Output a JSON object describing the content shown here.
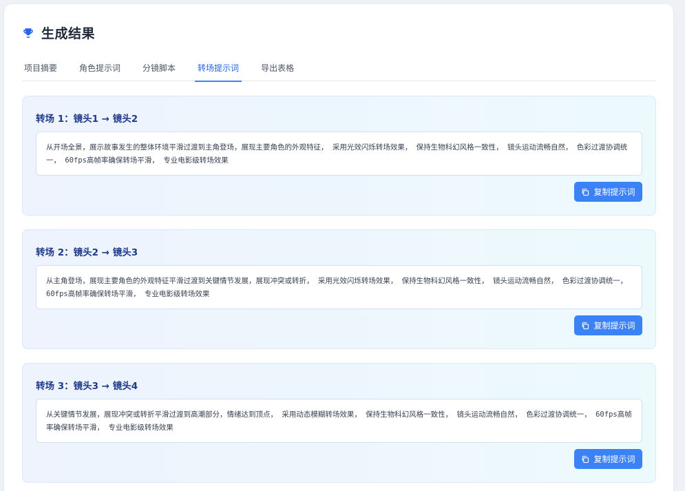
{
  "header": {
    "title": "生成结果",
    "icon": "trophy-icon"
  },
  "tabs": [
    {
      "label": "项目摘要"
    },
    {
      "label": "角色提示词"
    },
    {
      "label": "分镜脚本"
    },
    {
      "label": "转场提示词"
    },
    {
      "label": "导出表格"
    }
  ],
  "active_tab": "转场提示词",
  "cards": [
    {
      "title": "转场 1：镜头1 → 镜头2",
      "text": "从开场全景，展示故事发生的整体环境平滑过渡到主角登场，展现主要角色的外观特征， 采用光效闪烁转场效果， 保持生物科幻风格一致性， 镜头运动流畅自然， 色彩过渡协调统一， 60fps高帧率确保转场平滑， 专业电影级转场效果",
      "button": "复制提示词"
    },
    {
      "title": "转场 2：镜头2 → 镜头3",
      "text": "从主角登场，展现主要角色的外观特征平滑过渡到关键情节发展，展现冲突或转折， 采用光效闪烁转场效果， 保持生物科幻风格一致性， 镜头运动流畅自然， 色彩过渡协调统一， 60fps高帧率确保转场平滑， 专业电影级转场效果",
      "button": "复制提示词"
    },
    {
      "title": "转场 3：镜头3 → 镜头4",
      "text": "从关键情节发展，展现冲突或转折平滑过渡到高潮部分，情绪达到顶点， 采用动态模糊转场效果， 保持生物科幻风格一致性， 镜头运动流畅自然， 色彩过渡协调统一， 60fps高帧率确保转场平滑， 专业电影级转场效果",
      "button": "复制提示词"
    }
  ],
  "colors": {
    "accent": "#3b82f6",
    "card_title": "#1e3a8a",
    "active_tab": "#2563eb"
  }
}
